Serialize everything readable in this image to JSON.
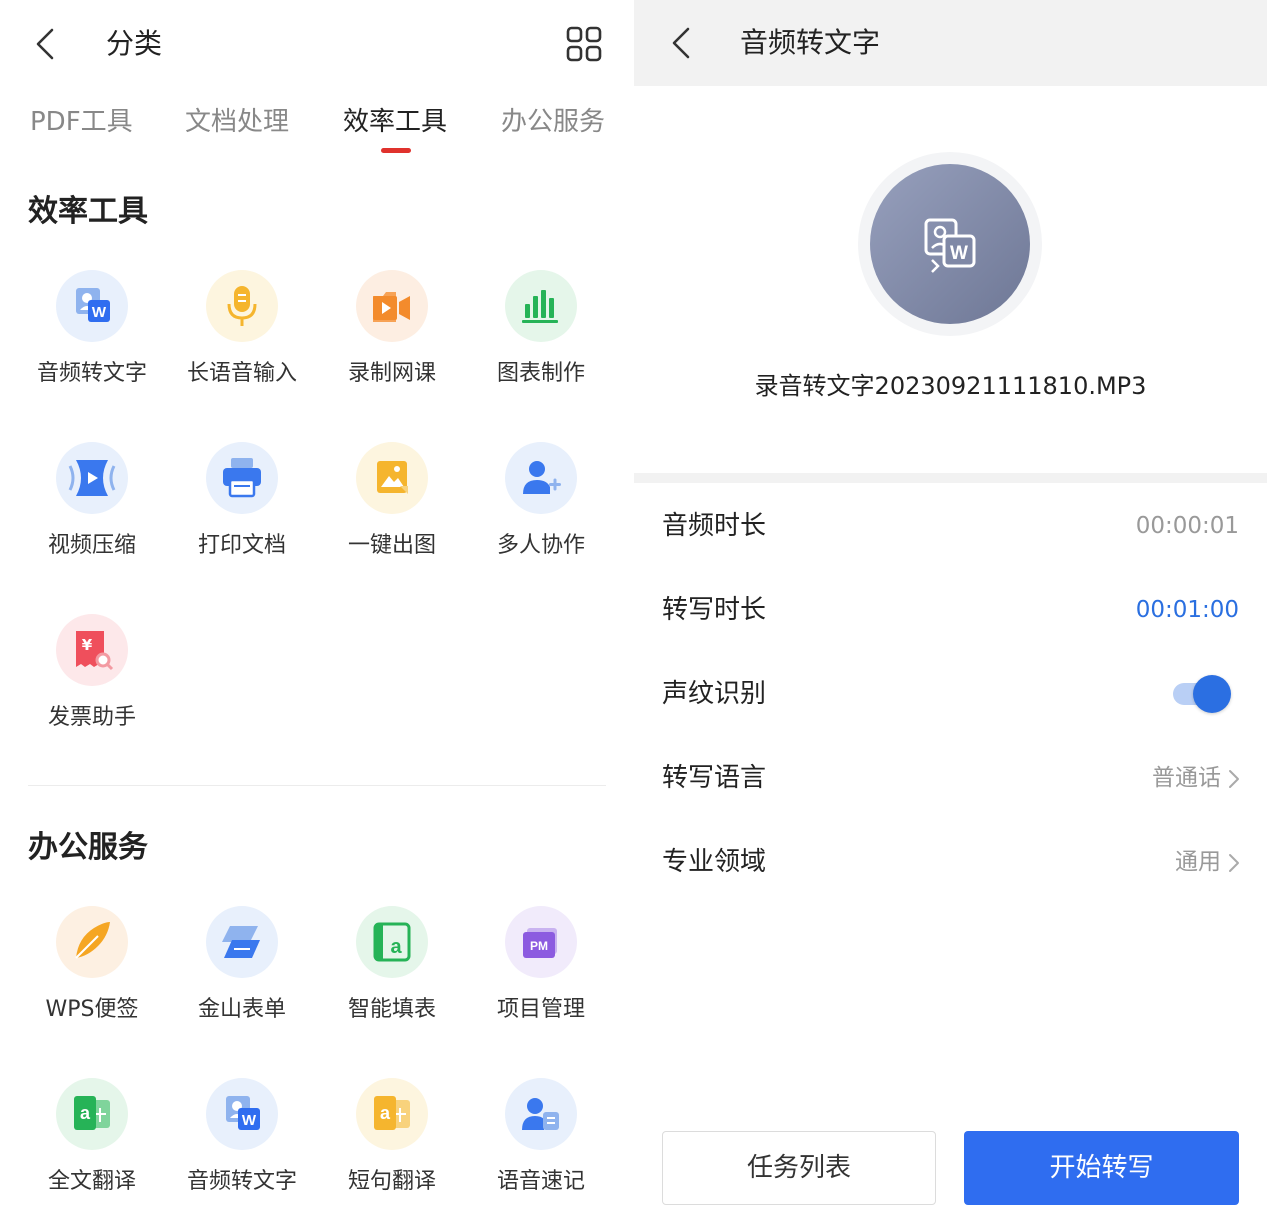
{
  "left": {
    "header": {
      "title": "分类"
    },
    "tabs": [
      {
        "label": "PDF工具"
      },
      {
        "label": "文档处理"
      },
      {
        "label": "效率工具"
      },
      {
        "label": "办公服务"
      }
    ],
    "active_tab": 2,
    "sections": [
      {
        "title": "效率工具",
        "items": [
          {
            "label": "音频转文字",
            "icon": "audio-to-text-icon"
          },
          {
            "label": "长语音输入",
            "icon": "microphone-icon"
          },
          {
            "label": "录制网课",
            "icon": "video-camera-icon"
          },
          {
            "label": "图表制作",
            "icon": "bar-chart-icon"
          },
          {
            "label": "视频压缩",
            "icon": "video-compress-icon"
          },
          {
            "label": "打印文档",
            "icon": "printer-icon"
          },
          {
            "label": "一键出图",
            "icon": "image-icon"
          },
          {
            "label": "多人协作",
            "icon": "add-user-icon"
          },
          {
            "label": "发票助手",
            "icon": "invoice-icon"
          }
        ]
      },
      {
        "title": "办公服务",
        "items": [
          {
            "label": "WPS便签",
            "icon": "feather-note-icon"
          },
          {
            "label": "金山表单",
            "icon": "form-icon"
          },
          {
            "label": "智能填表",
            "icon": "smart-form-icon"
          },
          {
            "label": "项目管理",
            "icon": "pm-icon",
            "glyph": "PM"
          },
          {
            "label": "全文翻译",
            "icon": "full-translate-icon"
          },
          {
            "label": "音频转文字",
            "icon": "audio-to-text-icon"
          },
          {
            "label": "短句翻译",
            "icon": "sentence-translate-icon"
          },
          {
            "label": "语音速记",
            "icon": "voice-note-icon"
          }
        ]
      }
    ]
  },
  "right": {
    "header": {
      "title": "音频转文字"
    },
    "file": {
      "name": "录音转文字20230921111810.MP3",
      "icon": "audio-to-word-icon"
    },
    "settings": [
      {
        "label": "音频时长",
        "value": "00:00:01"
      },
      {
        "label": "转写时长",
        "value": "00:01:00",
        "value_color": "#2a6fe0"
      },
      {
        "label": "声纹识别",
        "toggle": true
      },
      {
        "label": "转写语言",
        "value": "普通话"
      },
      {
        "label": "专业领域",
        "value": "通用"
      }
    ],
    "buttons": {
      "task_list": "任务列表",
      "start": "开始转写"
    }
  },
  "colors": {
    "accent_blue": "#2f6df0",
    "tab_indicator": "#e0322d",
    "header_bg": "#f2f2f2"
  }
}
